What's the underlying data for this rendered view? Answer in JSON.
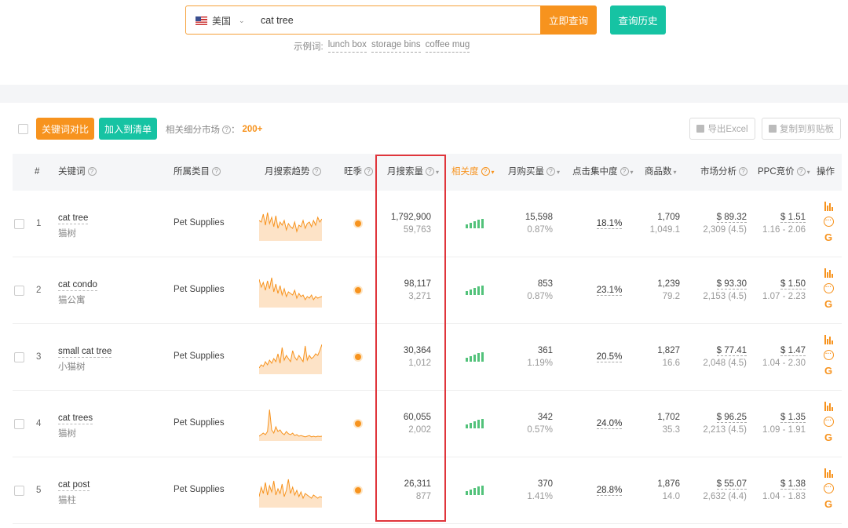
{
  "search": {
    "country": "美国",
    "query": "cat tree",
    "search_button": "立即查询",
    "history_button": "查询历史",
    "examples_label": "示例词:",
    "examples": [
      "lunch box",
      "storage bins",
      "coffee mug"
    ]
  },
  "toolbar": {
    "compare_button": "关键词对比",
    "add_list_button": "加入到清单",
    "market_label": "相关细分市场",
    "market_count": "200+",
    "export_excel": "导出Excel",
    "copy_clipboard": "复制到剪贴板"
  },
  "table": {
    "headers": {
      "index": "#",
      "keyword": "关键词",
      "category": "所属类目",
      "trend": "月搜索趋势",
      "peak": "旺季",
      "monthly_search": "月搜索量",
      "relevance": "相关度",
      "monthly_purchase": "月购买量",
      "click_concentration": "点击集中度",
      "product_count": "商品数",
      "market_analysis": "市场分析",
      "ppc": "PPC竞价",
      "actions": "操作"
    },
    "rows": [
      {
        "index": "1",
        "keyword_en": "cat tree",
        "keyword_cn": "猫树",
        "category": "Pet Supplies",
        "search_volume": "1,792,900",
        "search_daily": "59,763",
        "purchase": "15,598",
        "purchase_rate": "0.87%",
        "click_conc": "18.1%",
        "products": "1,709",
        "products_ratio": "1,049.1",
        "market_price": "$ 89.32",
        "market_reviews": "2,309 (4.5)",
        "ppc": "$ 1.51",
        "ppc_range": "1.16 - 2.06",
        "trend": [
          60,
          55,
          80,
          45,
          85,
          50,
          70,
          40,
          75,
          35,
          55,
          45,
          60,
          30,
          50,
          40,
          35,
          55,
          25,
          45,
          40,
          60,
          35,
          50,
          55,
          40,
          60,
          45,
          70,
          55,
          65
        ]
      },
      {
        "index": "2",
        "keyword_en": "cat condo",
        "keyword_cn": "猫公寓",
        "category": "Pet Supplies",
        "search_volume": "98,117",
        "search_daily": "3,271",
        "purchase": "853",
        "purchase_rate": "0.87%",
        "click_conc": "23.1%",
        "products": "1,239",
        "products_ratio": "79.2",
        "market_price": "$ 93.30",
        "market_reviews": "2,153 (4.5)",
        "ppc": "$ 1.50",
        "ppc_range": "1.07 - 2.23",
        "trend": [
          85,
          60,
          75,
          50,
          80,
          55,
          90,
          45,
          70,
          40,
          65,
          35,
          55,
          30,
          45,
          40,
          35,
          50,
          25,
          40,
          30,
          35,
          20,
          30,
          25,
          35,
          20,
          30,
          25,
          28,
          30
        ]
      },
      {
        "index": "3",
        "keyword_en": "small cat tree",
        "keyword_cn": "小猫树",
        "category": "Pet Supplies",
        "search_volume": "30,364",
        "search_daily": "1,012",
        "purchase": "361",
        "purchase_rate": "1.19%",
        "click_conc": "20.5%",
        "products": "1,827",
        "products_ratio": "16.6",
        "market_price": "$ 77.41",
        "market_reviews": "2,048 (4.5)",
        "ppc": "$ 1.47",
        "ppc_range": "1.04 - 2.30",
        "trend": [
          15,
          25,
          20,
          35,
          25,
          40,
          30,
          45,
          35,
          60,
          30,
          80,
          40,
          55,
          45,
          35,
          70,
          50,
          40,
          55,
          45,
          35,
          85,
          40,
          55,
          45,
          50,
          60,
          55,
          70,
          90
        ]
      },
      {
        "index": "4",
        "keyword_en": "cat trees",
        "keyword_cn": "猫树",
        "category": "Pet Supplies",
        "search_volume": "60,055",
        "search_daily": "2,002",
        "purchase": "342",
        "purchase_rate": "0.57%",
        "click_conc": "24.0%",
        "products": "1,702",
        "products_ratio": "35.3",
        "market_price": "$ 96.25",
        "market_reviews": "2,213 (4.5)",
        "ppc": "$ 1.35",
        "ppc_range": "1.09 - 1.91",
        "trend": [
          10,
          15,
          20,
          15,
          25,
          95,
          30,
          20,
          40,
          25,
          30,
          20,
          15,
          25,
          18,
          15,
          20,
          12,
          15,
          10,
          12,
          10,
          8,
          10,
          12,
          8,
          10,
          8,
          10,
          9,
          10
        ]
      },
      {
        "index": "5",
        "keyword_en": "cat post",
        "keyword_cn": "猫柱",
        "category": "Pet Supplies",
        "search_volume": "26,311",
        "search_daily": "877",
        "purchase": "370",
        "purchase_rate": "1.41%",
        "click_conc": "28.8%",
        "products": "1,876",
        "products_ratio": "14.0",
        "market_price": "$ 55.07",
        "market_reviews": "2,632 (4.4)",
        "ppc": "$ 1.38",
        "ppc_range": "1.04 - 1.83",
        "trend": [
          30,
          60,
          40,
          75,
          35,
          65,
          45,
          80,
          35,
          55,
          40,
          70,
          30,
          50,
          85,
          40,
          60,
          35,
          50,
          30,
          45,
          25,
          40,
          35,
          30,
          25,
          35,
          30,
          25,
          30,
          28
        ]
      }
    ]
  },
  "colors": {
    "orange": "#f7931e",
    "teal": "#16c3a3",
    "highlight": "#e0353b",
    "relevance": "#52c27a"
  }
}
